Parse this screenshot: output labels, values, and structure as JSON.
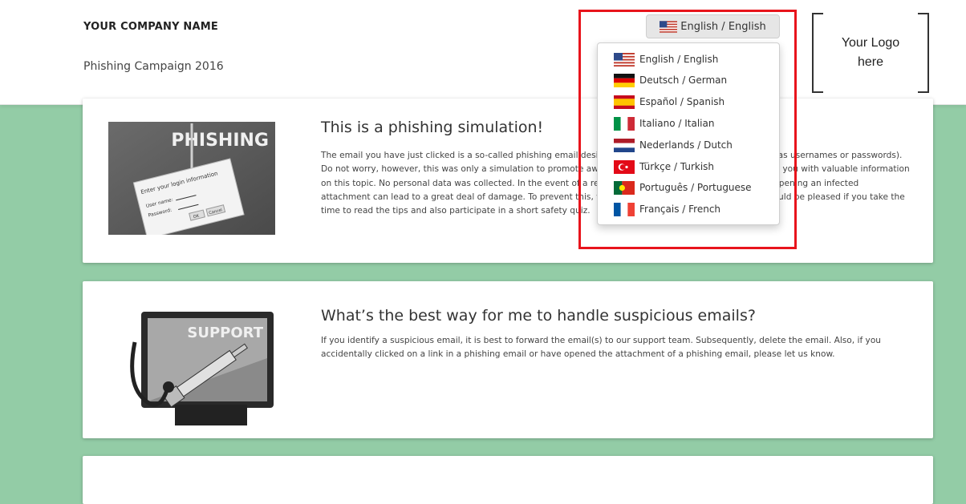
{
  "header": {
    "company_name": "YOUR COMPANY NAME",
    "campaign_name": "Phishing Campaign 2016",
    "language_button": {
      "label": "English / English",
      "flag_icon": "us-flag-icon"
    },
    "logo_text_line1": "Your Logo",
    "logo_text_line2": "here"
  },
  "language_menu": {
    "items": [
      {
        "label": "English / English",
        "icon": "us-flag-icon"
      },
      {
        "label": "Deutsch / German",
        "icon": "german-flag-icon"
      },
      {
        "label": "Español / Spanish",
        "icon": "spanish-flag-icon"
      },
      {
        "label": "Italiano / Italian",
        "icon": "italian-flag-icon"
      },
      {
        "label": "Nederlands / Dutch",
        "icon": "dutch-flag-icon"
      },
      {
        "label": "Türkçe / Turkish",
        "icon": "turkish-flag-icon"
      },
      {
        "label": "Português / Portuguese",
        "icon": "portuguese-flag-icon"
      },
      {
        "label": "Français / French",
        "icon": "french-flag-icon"
      }
    ]
  },
  "cards": [
    {
      "title": "This is a phishing simulation!",
      "body": "The email you have just clicked is a so-called phishing email designed to obtain sensitive information such as usernames or passwords). Do not worry, however, this was only a simulation to promote awareness about such attacks and to provide you with valuable information on this topic. No personal data was collected. In the event of a real attack, clicking on a phishing email or opening an infected attachment can lead to a great deal of damage. To prevent this, we depend on your help. Therefore, we would be pleased if you take the time to read the tips and also participate in a short safety quiz.",
      "image_label": "PHISHING",
      "image_form_title": "Enter your login information",
      "image_field1": "User name:",
      "image_field2": "Password:",
      "image_btn_ok": "OK",
      "image_btn_cancel": "Cancel"
    },
    {
      "title": "What’s the best way for me to handle suspicious emails?",
      "body": "If you identify a suspicious email, it is best to forward the email(s) to our support team. Subsequently, delete the email. Also, if you accidentally clicked on a link in a phishing email or have opened the attachment of a phishing email, please let us know.",
      "image_label": "SUPPORT"
    }
  ],
  "colors": {
    "page_background": "#93cca6",
    "highlight_border": "#e8141c",
    "card_background": "#ffffff"
  }
}
